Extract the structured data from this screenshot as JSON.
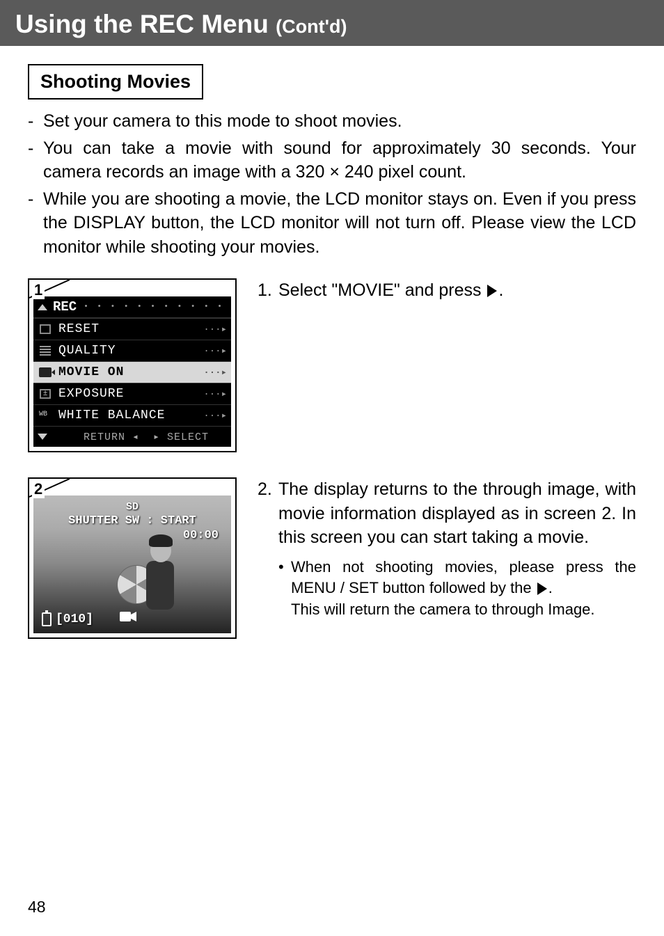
{
  "header": {
    "title": "Using the REC Menu ",
    "cont": "(Cont'd)"
  },
  "section_label": "Shooting Movies",
  "bullets": [
    "Set your camera to this mode to shoot movies.",
    "You can take a movie with sound for approximately 30 seconds. Your camera records an image with a 320 × 240 pixel count.",
    "While you are shooting a movie, the LCD monitor stays on. Even if you press the DISPLAY button, the LCD monitor will not turn off. Please view the LCD monitor while shooting your movies."
  ],
  "screenshot1": {
    "number": "1",
    "menu_title": "REC",
    "items": [
      {
        "label": "RESET",
        "selected": false
      },
      {
        "label": "QUALITY",
        "selected": false
      },
      {
        "label": "MOVIE ON",
        "selected": true
      },
      {
        "label": "EXPOSURE",
        "selected": false
      },
      {
        "label": "WHITE BALANCE",
        "selected": false
      }
    ],
    "footer_return": "RETURN",
    "footer_select": "SELECT"
  },
  "screenshot2": {
    "number": "2",
    "sd": "SD",
    "shutter": "SHUTTER SW : START",
    "time": "00:00",
    "counter": "[010]"
  },
  "step1": {
    "num": "1.",
    "text_before": "Select \"MOVIE\" and press ",
    "text_after": "."
  },
  "step2": {
    "num": "2.",
    "text": "The display returns to the through image, with movie information displayed as in screen 2. In this screen you can start taking a movie.",
    "sub_before": "When not shooting movies, please press the MENU / SET button followed by the ",
    "sub_after": ".",
    "sub_line2": "This will return the camera to through Image."
  },
  "page_number": "48"
}
